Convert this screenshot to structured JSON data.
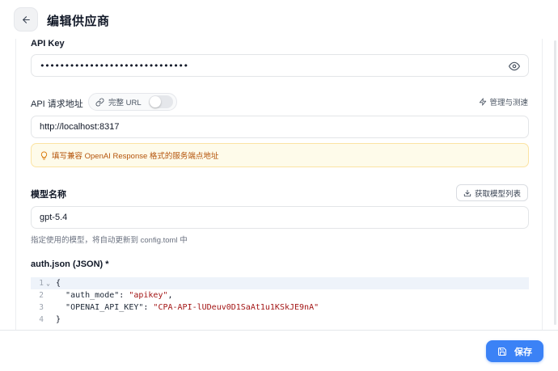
{
  "header": {
    "title": "编辑供应商"
  },
  "api_key": {
    "label": "API Key",
    "value": "••••••••••••••••••••••••••••••"
  },
  "endpoint": {
    "label": "API 请求地址",
    "full_url_toggle_label": "完整 URL",
    "full_url_enabled": false,
    "manage_label": "管理与测速",
    "value": "http://localhost:8317",
    "hint": "填写兼容 OpenAI Response 格式的服务端点地址"
  },
  "model": {
    "label": "模型名称",
    "fetch_label": "获取模型列表",
    "value": "gpt-5.4",
    "helper": "指定使用的模型，将自动更新到 config.toml 中"
  },
  "auth_json": {
    "label": "auth.json (JSON) *",
    "lines": [
      {
        "num": "1",
        "fold": "⌄",
        "open": "{"
      },
      {
        "num": "2",
        "key": "\"auth_mode\"",
        "sep": ": ",
        "val": "\"apikey\"",
        "end": ","
      },
      {
        "num": "3",
        "key": "\"OPENAI_API_KEY\"",
        "sep": ": ",
        "val": "\"CPA-API-lUDeuv0D1SaAt1u1KSkJE9nA\"",
        "end": ""
      },
      {
        "num": "4",
        "close": "}"
      }
    ]
  },
  "footer": {
    "save_label": "保存"
  },
  "colors": {
    "accent": "#3b82f6",
    "hint_bg": "#fefbea",
    "hint_text": "#b45309"
  },
  "icons": [
    "arrow-left-icon",
    "eye-icon",
    "link-icon",
    "zap-icon",
    "lightbulb-icon",
    "download-icon",
    "save-icon"
  ]
}
